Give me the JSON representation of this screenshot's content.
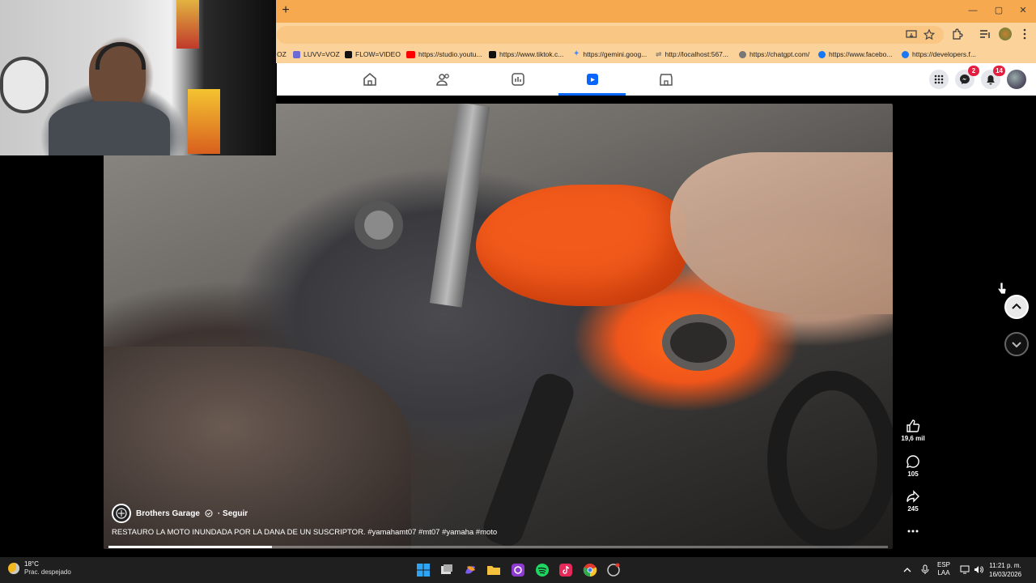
{
  "browser": {
    "new_tab_label": "+",
    "window_controls": {
      "minimize": "—",
      "maximize": "▢",
      "close": "✕"
    },
    "bookmarks": [
      {
        "label": "OZ",
        "color": "#555555"
      },
      {
        "label": "LUVV=VOZ",
        "color": "#6b6bd6"
      },
      {
        "label": "FLOW=VIDEO",
        "color": "#111111"
      },
      {
        "label": "https://studio.youtu...",
        "color": "#ff0000"
      },
      {
        "label": "https://www.tiktok.c...",
        "color": "#111111"
      },
      {
        "label": "https://gemini.goog...",
        "color": "#4a8bf5"
      },
      {
        "label": "http://localhost:567...",
        "color": "#888888"
      },
      {
        "label": "https://chatgpt.com/",
        "color": "#444444"
      },
      {
        "label": "https://www.facebo...",
        "color": "#1877f2"
      },
      {
        "label": "https://developers.f...",
        "color": "#1877f2"
      }
    ]
  },
  "facebook": {
    "nav_items": [
      "home-icon",
      "friends-icon",
      "dashboard-icon",
      "reels-icon",
      "marketplace-icon"
    ],
    "active_nav": "reels-icon",
    "messenger_badge": "2",
    "notifications_badge": "14"
  },
  "video": {
    "author": "Brothers Garage",
    "follow_label": "· Seguir",
    "description": "RESTAURO LA MOTO INUNDADA POR LA DANA DE UN SUSCRIPTOR. #yamahamt07 #mt07 #yamaha #moto",
    "progress": 0.21,
    "actions": {
      "likes": "19,6 mil",
      "comments": "105",
      "shares": "245"
    }
  },
  "taskbar": {
    "weather_temp": "18°C",
    "weather_desc": "Prac. despejado",
    "lang_line1": "ESP",
    "lang_line2": "LAA",
    "time": "11:21 p. m.",
    "date": "16/03/2026",
    "apps": [
      "windows-start-icon",
      "task-view-icon",
      "copilot-icon",
      "file-explorer-icon",
      "capture-app-icon",
      "spotify-icon",
      "tiktok-icon",
      "chrome-icon",
      "screen-recorder-icon"
    ]
  }
}
